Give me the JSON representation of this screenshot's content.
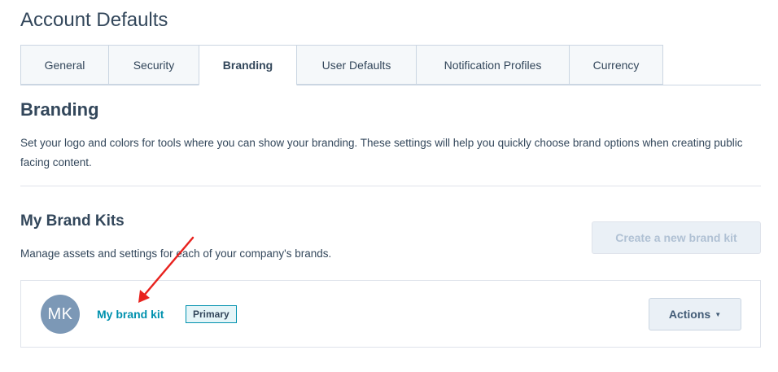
{
  "page": {
    "title": "Account Defaults"
  },
  "tabs": [
    {
      "label": "General",
      "active": false
    },
    {
      "label": "Security",
      "active": false
    },
    {
      "label": "Branding",
      "active": true
    },
    {
      "label": "User Defaults",
      "active": false
    },
    {
      "label": "Notification Profiles",
      "active": false
    },
    {
      "label": "Currency",
      "active": false
    }
  ],
  "branding": {
    "title": "Branding",
    "description": "Set your logo and colors for tools where you can show your branding. These settings will help you quickly choose brand options when creating public facing content."
  },
  "brand_kits": {
    "title": "My Brand Kits",
    "description": "Manage assets and settings for each of your company's brands.",
    "create_button_label": "Create a new brand kit",
    "create_button_disabled": true,
    "kits": [
      {
        "avatar_initials": "MK",
        "name": "My brand kit",
        "badge": "Primary",
        "actions_label": "Actions",
        "actions_icon": "caret-down-icon"
      }
    ]
  },
  "annotation": {
    "type": "red-arrow",
    "color": "#e8231f",
    "points_to": "My brand kit"
  },
  "colors": {
    "text": "#33475b",
    "link": "#0091ae",
    "avatar": "#7c98b6",
    "button_bg": "#eaf0f6",
    "disabled_text": "#b0c1d4"
  }
}
